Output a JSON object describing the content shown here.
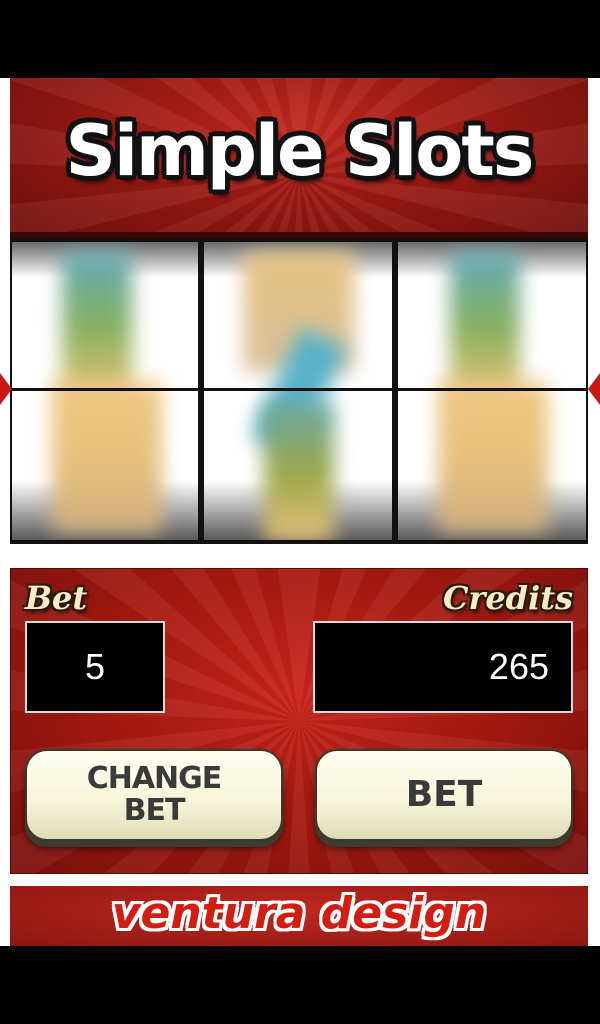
{
  "title": "Simple Slots",
  "reels": {
    "count": 3,
    "state": "spinning-blurred"
  },
  "controls": {
    "bet_label": "Bet",
    "credits_label": "Credits",
    "bet_value": "5",
    "credits_value": "265",
    "change_bet_line1": "CHANGE",
    "change_bet_line2": "BET",
    "bet_button_label": "BET"
  },
  "footer": {
    "brand": "ventura design"
  },
  "colors": {
    "panel_red": "#a01810",
    "marker_red": "#c81a12",
    "button_cream": "#f6f4d8",
    "display_black": "#000000",
    "label_cream": "#f3ecc6"
  }
}
